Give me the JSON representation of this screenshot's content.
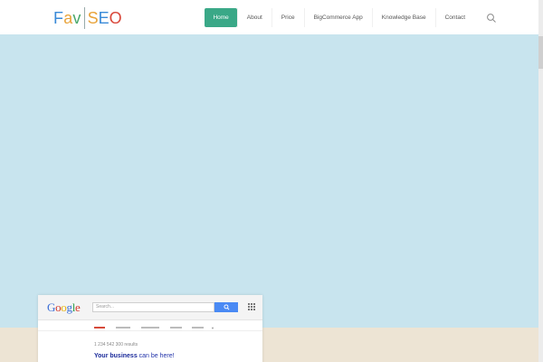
{
  "brand": {
    "logo_left": "Fav",
    "logo_right": "SEO"
  },
  "nav": {
    "items": [
      {
        "label": "Home",
        "active": true
      },
      {
        "label": "About",
        "active": false
      },
      {
        "label": "Price",
        "active": false
      },
      {
        "label": "BigCommerce App",
        "active": false
      },
      {
        "label": "Knowledge Base",
        "active": false
      },
      {
        "label": "Contact",
        "active": false
      }
    ],
    "search_icon": "search-icon"
  },
  "colors": {
    "accent": "#3aa887",
    "hero_bg": "#c8e4ee",
    "sand": "#ede4d4"
  },
  "google_mock": {
    "logo": "Google",
    "search_placeholder": "Search...",
    "results_count": "1 234 542 300 results",
    "first_result_bold": "Your business",
    "first_result_rest": " can be here!"
  }
}
